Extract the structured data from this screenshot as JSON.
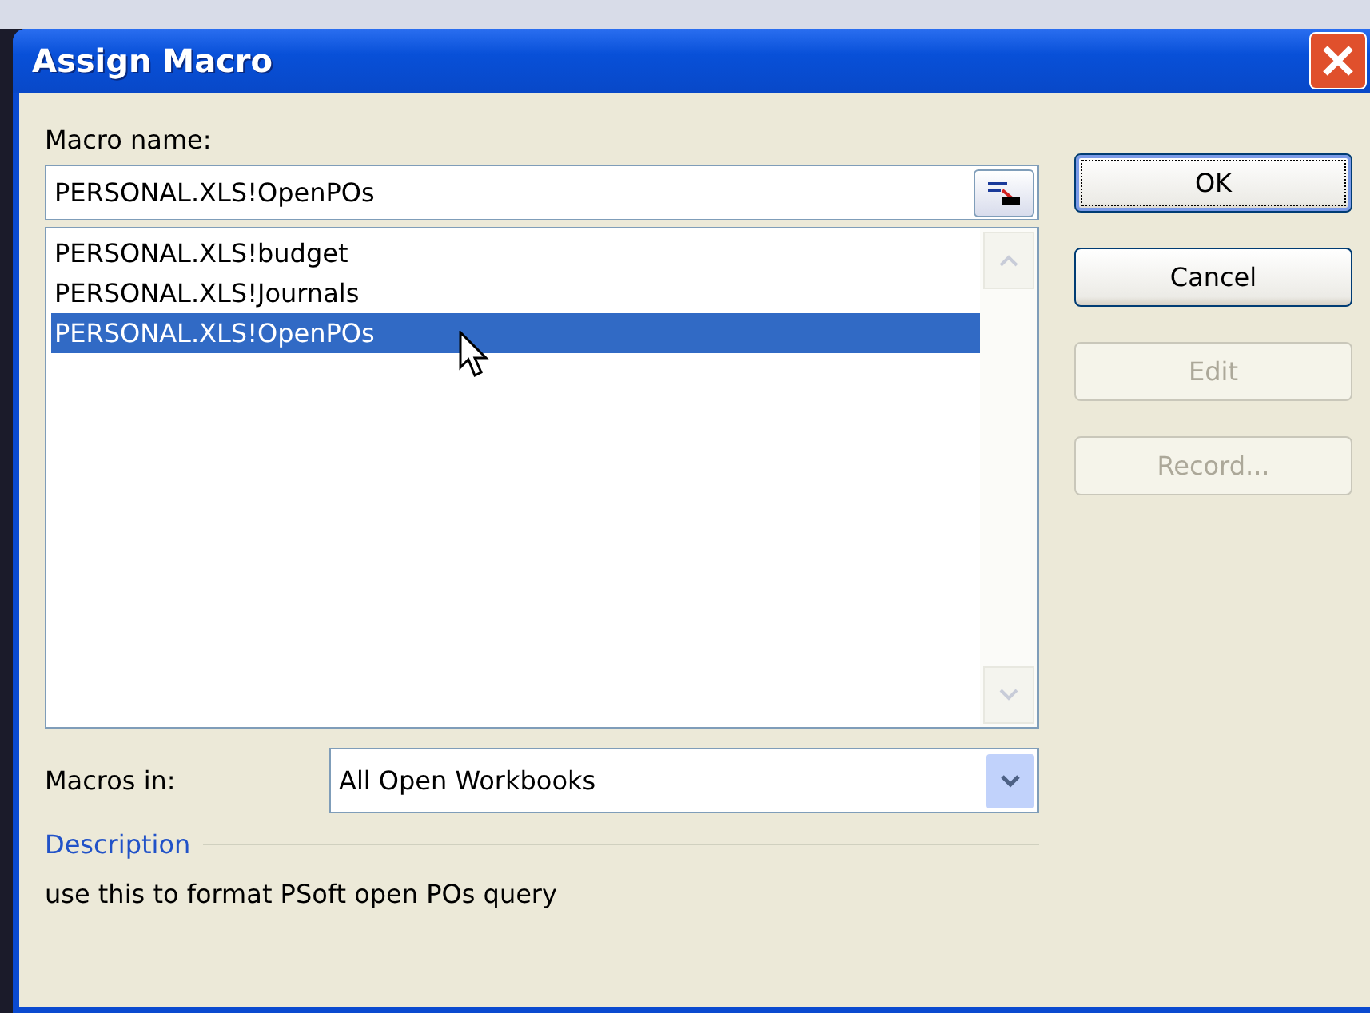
{
  "window": {
    "title": "Assign Macro"
  },
  "macro_name": {
    "label": "Macro name:",
    "value": "PERSONAL.XLS!OpenPOs"
  },
  "macro_list": [
    {
      "label": "PERSONAL.XLS!budget",
      "selected": false
    },
    {
      "label": "PERSONAL.XLS!Journals",
      "selected": false
    },
    {
      "label": "PERSONAL.XLS!OpenPOs",
      "selected": true
    }
  ],
  "buttons": [
    {
      "label": "OK",
      "default": true,
      "disabled": false
    },
    {
      "label": "Cancel",
      "default": false,
      "disabled": false
    },
    {
      "label": "Edit",
      "default": false,
      "disabled": true
    },
    {
      "label": "Record...",
      "default": false,
      "disabled": true
    }
  ],
  "macros_in": {
    "label": "Macros in:",
    "value": "All Open Workbooks"
  },
  "description": {
    "heading": "Description",
    "text": "use this to format PSoft open POs query"
  }
}
